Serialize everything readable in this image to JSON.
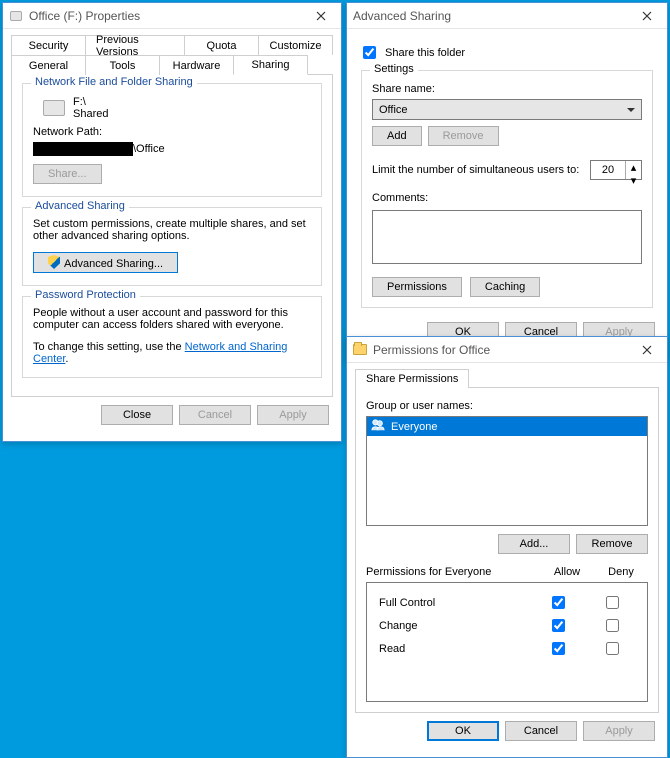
{
  "props": {
    "title": "Office (F:) Properties",
    "tabs_row1": [
      "Security",
      "Previous Versions",
      "Quota",
      "Customize"
    ],
    "tabs_row2": [
      "General",
      "Tools",
      "Hardware",
      "Sharing"
    ],
    "active_tab": "Sharing",
    "nfs": {
      "legend": "Network File and Folder Sharing",
      "drive_name": "F:\\",
      "drive_status": "Shared",
      "network_path_label": "Network Path:",
      "network_path_suffix": "\\Office",
      "share_btn": "Share..."
    },
    "adv": {
      "legend": "Advanced Sharing",
      "text": "Set custom permissions, create multiple shares, and set other advanced sharing options.",
      "btn": "Advanced Sharing..."
    },
    "pwd": {
      "legend": "Password Protection",
      "text": "People without a user account and password for this computer can access folders shared with everyone.",
      "link_pre": "To change this setting, use the ",
      "link": "Network and Sharing Center",
      "link_post": "."
    },
    "footer": {
      "close": "Close",
      "cancel": "Cancel",
      "apply": "Apply"
    }
  },
  "advshare": {
    "title": "Advanced Sharing",
    "share_chk_label": "Share this folder",
    "share_chk": true,
    "settings_legend": "Settings",
    "share_name_label": "Share name:",
    "share_name_value": "Office",
    "add_btn": "Add",
    "remove_btn": "Remove",
    "limit_label": "Limit the number of simultaneous users to:",
    "limit_value": "20",
    "comments_label": "Comments:",
    "comments_value": "",
    "perm_btn": "Permissions",
    "cache_btn": "Caching",
    "footer": {
      "ok": "OK",
      "cancel": "Cancel",
      "apply": "Apply"
    }
  },
  "perms": {
    "title": "Permissions for Office",
    "tab": "Share Permissions",
    "groups_label": "Group or user names:",
    "selected_user": "Everyone",
    "add_btn": "Add...",
    "remove_btn": "Remove",
    "perm_for_label": "Permissions for Everyone",
    "col_allow": "Allow",
    "col_deny": "Deny",
    "rows": [
      {
        "label": "Full Control",
        "allow": true,
        "deny": false
      },
      {
        "label": "Change",
        "allow": true,
        "deny": false
      },
      {
        "label": "Read",
        "allow": true,
        "deny": false
      }
    ],
    "footer": {
      "ok": "OK",
      "cancel": "Cancel",
      "apply": "Apply"
    }
  }
}
